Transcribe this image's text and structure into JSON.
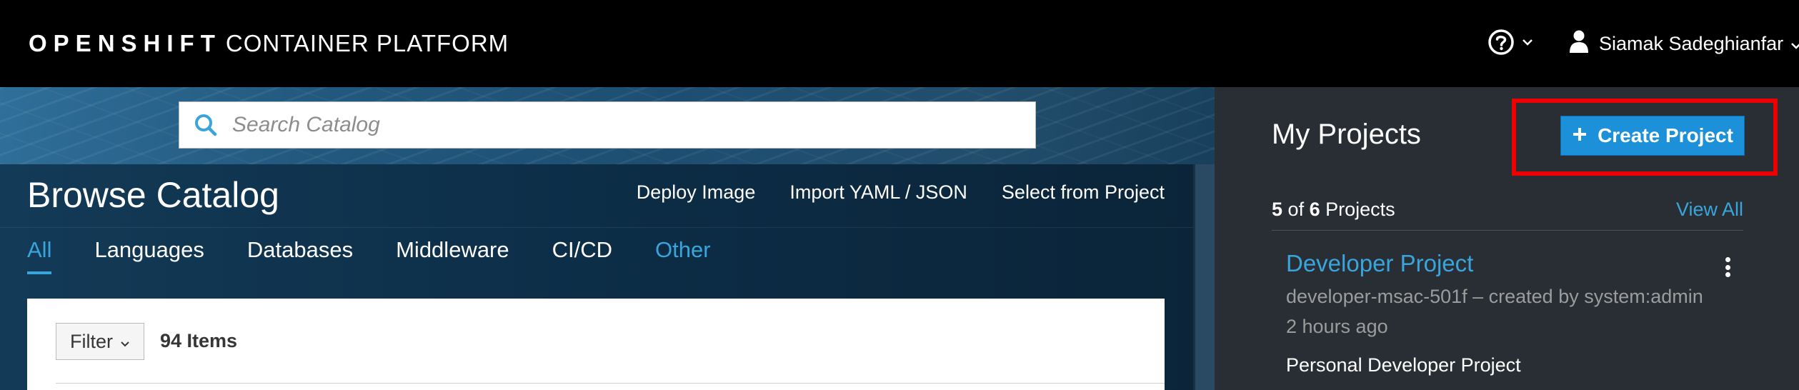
{
  "masthead": {
    "brand_strong": "OPENSHIFT",
    "brand_light": "CONTAINER PLATFORM",
    "help_icon": "question-circle-icon",
    "user_name": "Siamak Sadeghianfar"
  },
  "catalog": {
    "search_placeholder": "Search Catalog",
    "title": "Browse Catalog",
    "actions": [
      "Deploy Image",
      "Import YAML / JSON",
      "Select from Project"
    ],
    "tabs": [
      "All",
      "Languages",
      "Databases",
      "Middleware",
      "CI/CD",
      "Other"
    ],
    "active_tab": "All",
    "filter_label": "Filter",
    "items_count": "94 Items"
  },
  "projects": {
    "title": "My Projects",
    "create_label": "Create Project",
    "summary_shown": "5",
    "summary_of": "of",
    "summary_total": "6",
    "summary_suffix": "Projects",
    "view_all": "View All",
    "items": [
      {
        "name": "Developer Project",
        "meta": "developer-msac-501f – created by system:admin",
        "time": "2 hours ago",
        "description": "Personal Developer Project"
      }
    ]
  },
  "colors": {
    "accent": "#39a5dc",
    "primary_button": "#1c90d9",
    "highlight_outline": "#ee0000",
    "panel_bg": "#292e34"
  }
}
